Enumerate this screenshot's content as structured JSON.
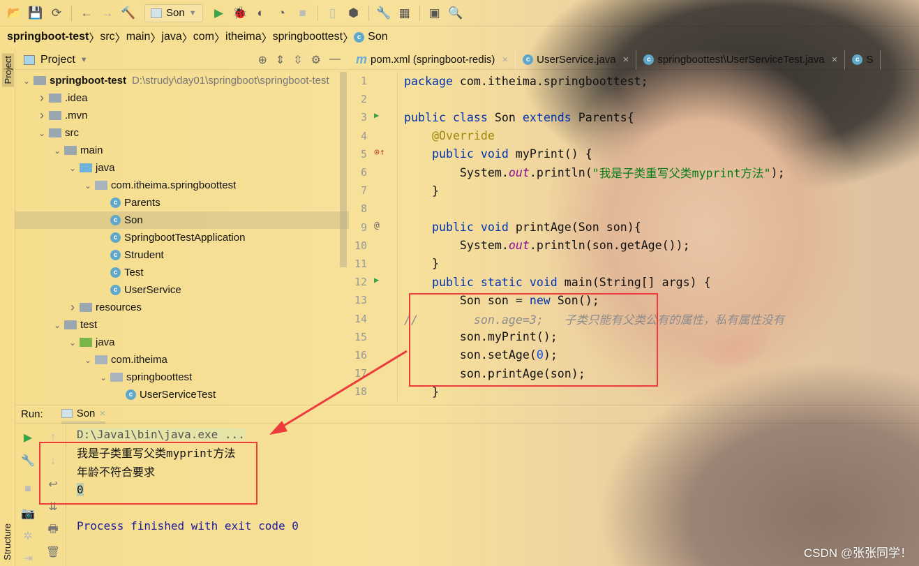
{
  "toolbar": {
    "run_config": "Son",
    "icons": [
      "open-icon",
      "save-icon",
      "sync-icon",
      "back-icon",
      "forward-icon",
      "build-hammer-icon",
      "run-icon",
      "debug-icon",
      "coverage-icon",
      "profile-icon",
      "stop-icon",
      "device-icon",
      "sdk-icon",
      "wrench-icon",
      "project-structure-icon",
      "terminal-icon",
      "search-icon"
    ]
  },
  "breadcrumb": [
    "springboot-test",
    "src",
    "main",
    "java",
    "com",
    "itheima",
    "springboottest",
    "Son"
  ],
  "left_stripe": {
    "project_tab": "Project",
    "structure_tab": "Structure"
  },
  "project_panel": {
    "title": "Project",
    "tree": [
      {
        "label": "springboot-test",
        "path": "D:\\strudy\\day01\\springboot\\springboot-test",
        "level": 0,
        "state": "open",
        "kind": "module"
      },
      {
        "label": ".idea",
        "level": 1,
        "state": "closed",
        "kind": "folder"
      },
      {
        "label": ".mvn",
        "level": 1,
        "state": "closed",
        "kind": "folder"
      },
      {
        "label": "src",
        "level": 1,
        "state": "open",
        "kind": "folder"
      },
      {
        "label": "main",
        "level": 2,
        "state": "open",
        "kind": "folder"
      },
      {
        "label": "java",
        "level": 3,
        "state": "open",
        "kind": "src"
      },
      {
        "label": "com.itheima.springboottest",
        "level": 4,
        "state": "open",
        "kind": "package"
      },
      {
        "label": "Parents",
        "level": 5,
        "kind": "class"
      },
      {
        "label": "Son",
        "level": 5,
        "kind": "class",
        "selected": true
      },
      {
        "label": "SpringbootTestApplication",
        "level": 5,
        "kind": "class"
      },
      {
        "label": "Strudent",
        "level": 5,
        "kind": "class"
      },
      {
        "label": "Test",
        "level": 5,
        "kind": "class"
      },
      {
        "label": "UserService",
        "level": 5,
        "kind": "class"
      },
      {
        "label": "resources",
        "level": 3,
        "state": "closed",
        "kind": "folder"
      },
      {
        "label": "test",
        "level": 2,
        "state": "open",
        "kind": "folder"
      },
      {
        "label": "java",
        "level": 3,
        "state": "open",
        "kind": "test"
      },
      {
        "label": "com.itheima",
        "level": 4,
        "state": "open",
        "kind": "package"
      },
      {
        "label": "springboottest",
        "level": 5,
        "state": "open",
        "kind": "package"
      },
      {
        "label": "UserServiceTest",
        "level": 6,
        "kind": "class"
      }
    ]
  },
  "editor": {
    "tabs": [
      {
        "label": "pom.xml (springboot-redis)",
        "icon": "m",
        "close": "×"
      },
      {
        "label": "UserService.java",
        "icon": "c",
        "close": "×"
      },
      {
        "label": "springboottest\\UserServiceTest.java",
        "icon": "c",
        "close": "×"
      },
      {
        "label": "S",
        "icon": "c",
        "close": ""
      }
    ],
    "lines": [
      {
        "n": "1",
        "t": [
          [
            "package",
            "kw"
          ],
          [
            " com.itheima.springboottest;",
            ""
          ]
        ]
      },
      {
        "n": "2",
        "t": []
      },
      {
        "n": "3",
        "g": "run",
        "t": [
          [
            "public class",
            "kw"
          ],
          [
            " Son ",
            ""
          ],
          [
            "extends",
            "kw"
          ],
          [
            " Parents{",
            ""
          ]
        ]
      },
      {
        "n": "4",
        "t": [
          [
            "    ",
            ""
          ],
          [
            "@Override",
            "ann"
          ]
        ]
      },
      {
        "n": "5",
        "g": "override",
        "t": [
          [
            "    ",
            ""
          ],
          [
            "public void",
            "kw"
          ],
          [
            " myPrint() {",
            ""
          ]
        ]
      },
      {
        "n": "6",
        "t": [
          [
            "        System.",
            ""
          ],
          [
            "out",
            "st"
          ],
          [
            ".println(",
            ""
          ],
          [
            "\"我是子类重写父类myprint方法\"",
            "str"
          ],
          [
            ");",
            ""
          ]
        ]
      },
      {
        "n": "7",
        "t": [
          [
            "    }",
            ""
          ]
        ]
      },
      {
        "n": "8",
        "t": []
      },
      {
        "n": "9",
        "g": "at",
        "t": [
          [
            "    ",
            ""
          ],
          [
            "public void",
            "kw"
          ],
          [
            " printAge(Son son){",
            ""
          ]
        ]
      },
      {
        "n": "10",
        "t": [
          [
            "        System.",
            ""
          ],
          [
            "out",
            "st"
          ],
          [
            ".println(son.getAge());",
            ""
          ]
        ]
      },
      {
        "n": "11",
        "t": [
          [
            "    }",
            ""
          ]
        ]
      },
      {
        "n": "12",
        "g": "run",
        "t": [
          [
            "    ",
            ""
          ],
          [
            "public static void",
            "kw"
          ],
          [
            " main(String[] args) {",
            ""
          ]
        ]
      },
      {
        "n": "13",
        "t": [
          [
            "        Son son = ",
            ""
          ],
          [
            "new",
            "kw"
          ],
          [
            " Son();",
            ""
          ]
        ]
      },
      {
        "n": "14",
        "t": [
          [
            "//        son.age=3;   子类只能有父类公有的属性，私有属性没有",
            "cm"
          ]
        ]
      },
      {
        "n": "15",
        "t": [
          [
            "        son.myPrint();",
            ""
          ]
        ]
      },
      {
        "n": "16",
        "t": [
          [
            "        son.setAge(",
            ""
          ],
          [
            "0",
            "num"
          ],
          [
            ");",
            ""
          ]
        ]
      },
      {
        "n": "17",
        "t": [
          [
            "        son.printAge(son);",
            ""
          ]
        ]
      },
      {
        "n": "18",
        "t": [
          [
            "    }",
            ""
          ]
        ]
      }
    ]
  },
  "run_panel": {
    "label": "Run:",
    "tab": "Son",
    "tab_close": "×",
    "output": [
      {
        "text": "D:\\Java1\\bin\\java.exe ...",
        "color": "#555555"
      },
      {
        "text": "我是子类重写父类myprint方法",
        "color": "#111111"
      },
      {
        "text": "年龄不符合要求",
        "color": "#111111"
      },
      {
        "text": "0",
        "color": "#111111"
      },
      {
        "text": "",
        "color": "#111111"
      },
      {
        "text": "Process finished with exit code 0",
        "color": "#1b1b9c"
      }
    ]
  },
  "annotation_color": "#ec3b3b",
  "watermark": "CSDN @张张同学！"
}
